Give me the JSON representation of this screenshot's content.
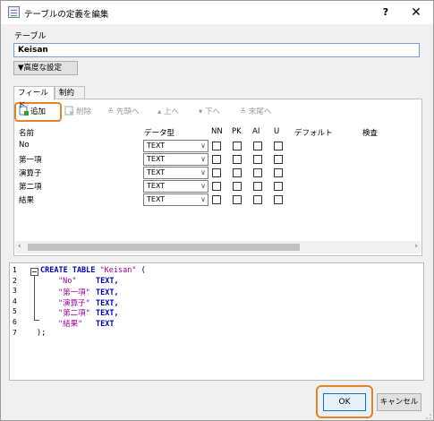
{
  "window": {
    "title": "テーブルの定義を編集",
    "help": "?",
    "close": "✕"
  },
  "table_label": "テーブル",
  "table_name": "Keisan",
  "advanced_button": "▼高度な設定",
  "tabs": [
    {
      "label": "フィールド"
    },
    {
      "label": "制約"
    }
  ],
  "toolbar": {
    "add": "追加",
    "delete": "削除",
    "first": "先頭へ",
    "up": "上へ",
    "down": "下へ",
    "last": "末尾へ"
  },
  "grid": {
    "headers": {
      "name": "名前",
      "type": "データ型",
      "nn": "NN",
      "pk": "PK",
      "ai": "AI",
      "u": "U",
      "default": "デフォルト",
      "check": "検査"
    },
    "rows": [
      {
        "name": "No",
        "type": "TEXT"
      },
      {
        "name": "第一項",
        "type": "TEXT"
      },
      {
        "name": "演算子",
        "type": "TEXT"
      },
      {
        "name": "第二項",
        "type": "TEXT"
      },
      {
        "name": "結果",
        "type": "TEXT"
      }
    ]
  },
  "sql": {
    "line_numbers": [
      "1",
      "2",
      "3",
      "4",
      "5",
      "6",
      "7"
    ],
    "l1_kw": "CREATE TABLE",
    "l1_name": "\"Keisan\"",
    "l1_tail": " (",
    "cols": [
      {
        "name": "\"No\"",
        "type": "TEXT,"
      },
      {
        "name": "\"第一項\"",
        "type": "TEXT,"
      },
      {
        "name": "\"演算子\"",
        "type": "TEXT,"
      },
      {
        "name": "\"第二項\"",
        "type": "TEXT,"
      },
      {
        "name": "\"結果\"",
        "type": "TEXT"
      }
    ],
    "l7": ");"
  },
  "buttons": {
    "ok": "OK",
    "cancel": "キャンセル"
  },
  "colors": {
    "highlight": "#e8822a",
    "keyword": "#0000c0",
    "string": "#a000a0"
  }
}
